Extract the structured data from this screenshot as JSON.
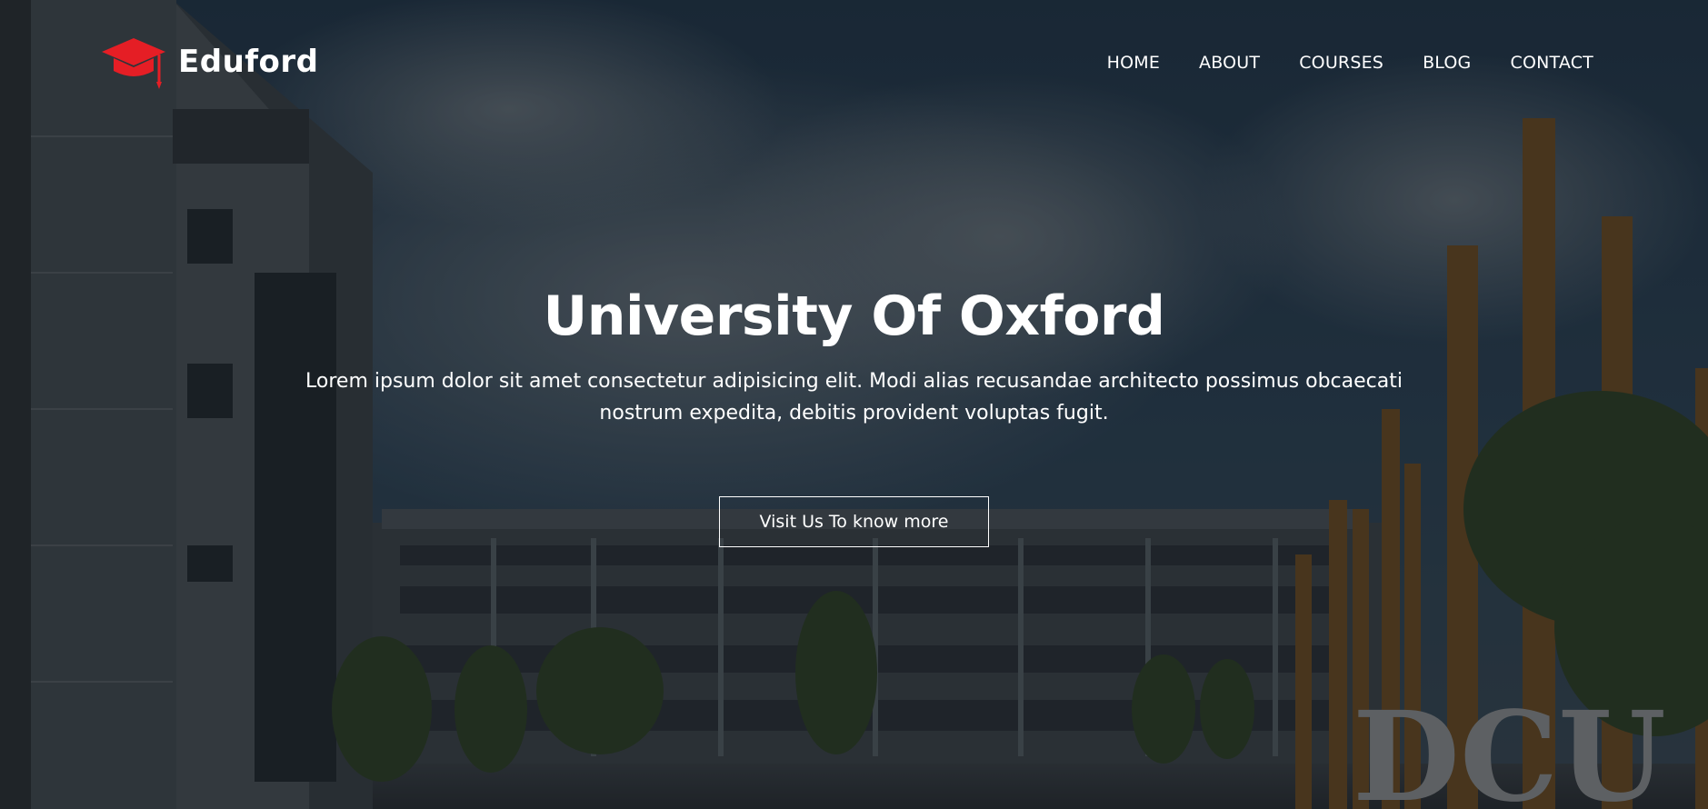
{
  "brand": {
    "name": "Eduford",
    "icon": "graduation-cap-icon",
    "accent_color": "#e51e25"
  },
  "nav": {
    "items": [
      {
        "label": "HOME"
      },
      {
        "label": "ABOUT"
      },
      {
        "label": "COURSES"
      },
      {
        "label": "BLOG"
      },
      {
        "label": "CONTACT"
      }
    ]
  },
  "hero": {
    "title": "University Of Oxford",
    "text": "Lorem ipsum dolor sit amet consectetur adipisicing elit. Modi alias recusandae architecto possimus obcaecati nostrum expedita, debitis provident voluptas fugit.",
    "cta_label": "Visit Us To know more",
    "background_sign": "DCU"
  }
}
